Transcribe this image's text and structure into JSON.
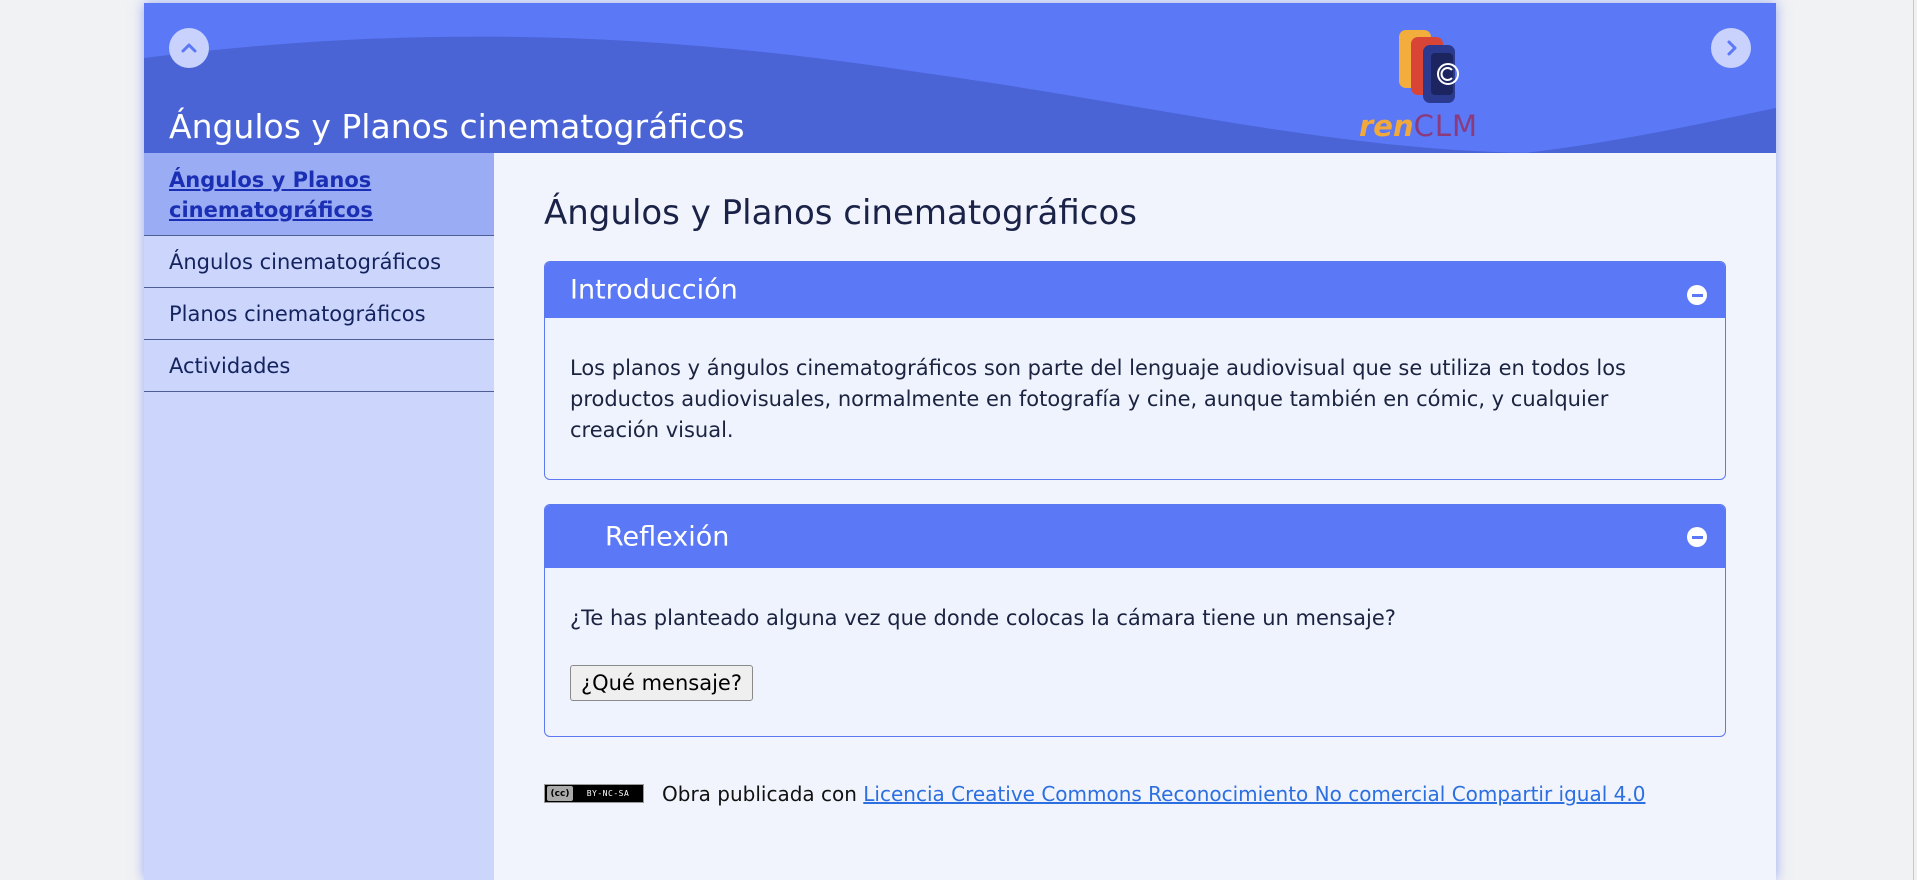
{
  "header": {
    "title": "Ángulos y Planos cinematográficos",
    "prev_icon": "chevron-up-icon",
    "next_icon": "chevron-right-icon",
    "logo": {
      "part1": "ren",
      "part2": "CLM"
    }
  },
  "sidebar": {
    "items": [
      {
        "label": "Ángulos y Planos cinematográficos",
        "active": true
      },
      {
        "label": "Ángulos cinematográficos"
      },
      {
        "label": "Planos cinematográficos"
      },
      {
        "label": "Actividades"
      }
    ]
  },
  "main": {
    "title": "Ángulos y Planos cinematográficos",
    "sections": [
      {
        "heading": "Introducción",
        "text": "Los planos y ángulos cinematográficos son parte del lenguaje audiovisual que se utiliza en todos los productos audiovisuales, normalmente en fotografía y cine, aunque también en cómic, y cualquier creación visual."
      },
      {
        "heading": "Reflexión",
        "text": "¿Te has planteado alguna vez que donde colocas la cámara tiene un mensaje?",
        "button": "¿Qué mensaje?"
      }
    ]
  },
  "footer": {
    "cc_badge": "BY-NC-SA",
    "cc_symbol": "(cc)",
    "text": "Obra publicada con",
    "link": "Licencia Creative Commons Reconocimiento No comercial Compartir igual 4.0"
  },
  "colors": {
    "accent": "#5b78f6",
    "sidebar_bg": "#ccd5fc",
    "sidebar_active": "#9aacf4",
    "content_bg": "#f1f4fc"
  }
}
